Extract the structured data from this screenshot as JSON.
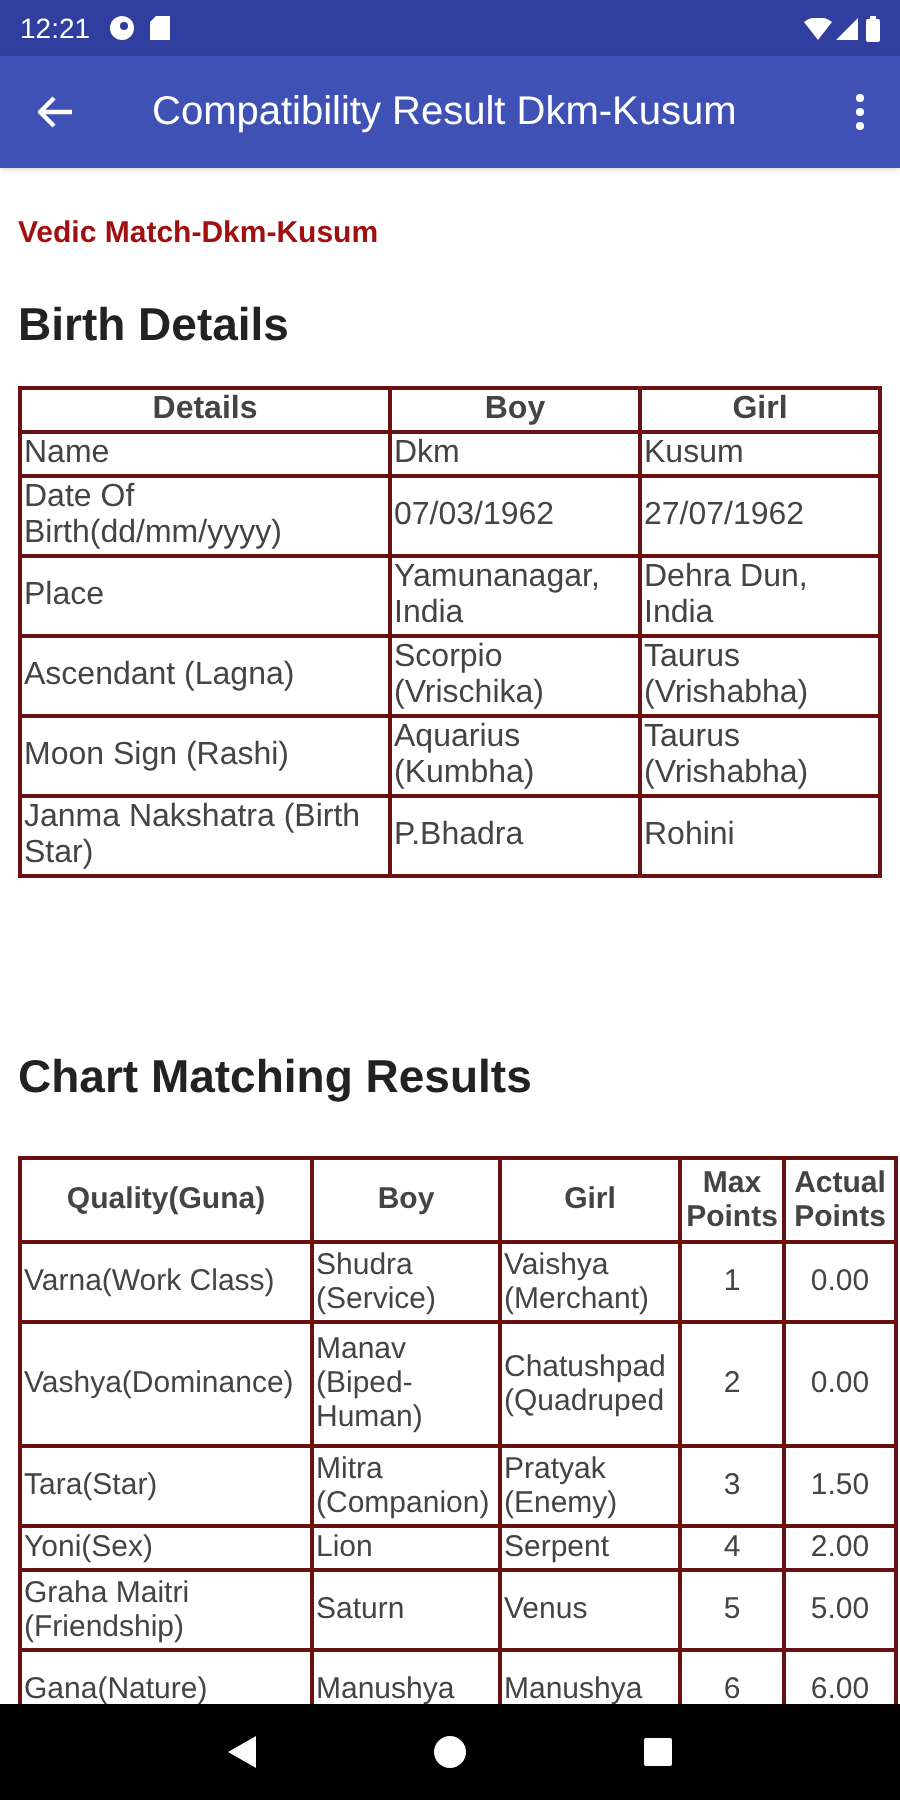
{
  "status_bar": {
    "time": "12:21"
  },
  "app_bar": {
    "title": "Compatibility Result Dkm-Kusum"
  },
  "subtitle": "Vedic Match-Dkm-Kusum",
  "birth_details": {
    "heading": "Birth Details",
    "columns": [
      "Details",
      "Boy",
      "Girl"
    ],
    "rows": [
      [
        "Name",
        "Dkm",
        "Kusum"
      ],
      [
        "Date Of Birth(dd/mm/yyyy)",
        "07/03/1962",
        "27/07/1962"
      ],
      [
        "Place",
        "Yamunanagar, India",
        "Dehra Dun, India"
      ],
      [
        "Ascendant (Lagna)",
        "Scorpio (Vrischika)",
        "Taurus (Vrishabha)"
      ],
      [
        "Moon Sign (Rashi)",
        "Aquarius (Kumbha)",
        "Taurus (Vrishabha)"
      ],
      [
        "Janma Nakshatra (Birth Star)",
        "P.Bhadra",
        "Rohini"
      ]
    ]
  },
  "chart_matching": {
    "heading": "Chart Matching Results",
    "columns": [
      "Quality(Guna)",
      "Boy",
      "Girl",
      "Max Points",
      "Actual Points"
    ],
    "rows": [
      [
        "Varna(Work Class)",
        "Shudra (Service)",
        "Vaishya (Merchant)",
        "1",
        "0.00"
      ],
      [
        "Vashya(Dominance)",
        "Manav (Biped-Human)",
        "Chatushpad (Quadruped",
        "2",
        "0.00"
      ],
      [
        "Tara(Star)",
        "Mitra (Companion)",
        "Pratyak (Enemy)",
        "3",
        "1.50"
      ],
      [
        "Yoni(Sex)",
        "Lion",
        "Serpent",
        "4",
        "2.00"
      ],
      [
        "Graha Maitri (Friendship)",
        "Saturn",
        "Venus",
        "5",
        "5.00"
      ],
      [
        "Gana(Nature)",
        "Manushya",
        "Manushya",
        "6",
        "6.00"
      ]
    ]
  }
}
